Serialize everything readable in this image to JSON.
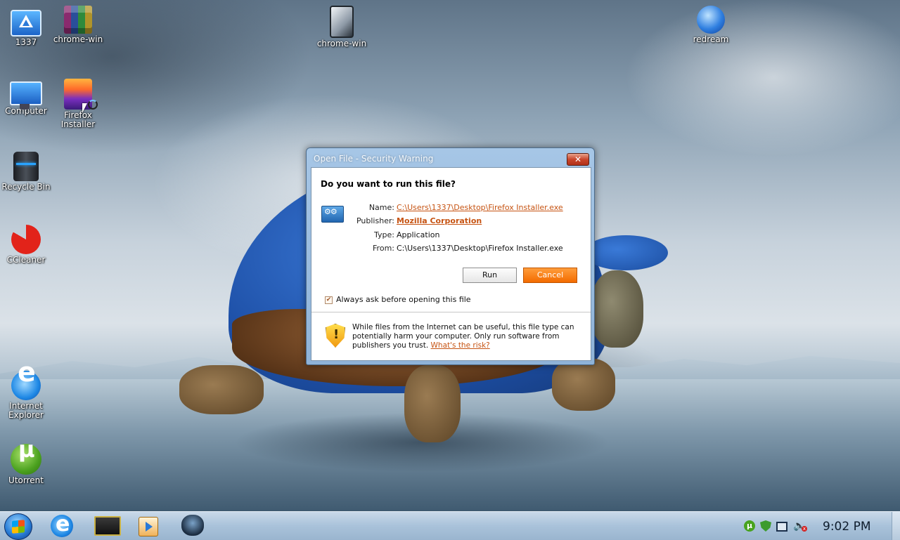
{
  "desktop": {
    "icons": [
      {
        "label": "1337",
        "icon": "triangle-logo-icon"
      },
      {
        "label": "chrome-win",
        "icon": "books-archive-icon"
      },
      {
        "label": "chrome-win",
        "icon": "phone-icon"
      },
      {
        "label": "redream",
        "icon": "redream-swirl-icon"
      },
      {
        "label": "Computer",
        "icon": "computer-icon"
      },
      {
        "label": "Firefox\nInstaller",
        "icon": "installer-icon"
      },
      {
        "label": "Recycle Bin",
        "icon": "recycle-bin-icon"
      },
      {
        "label": "CCleaner",
        "icon": "ccleaner-icon"
      },
      {
        "label": "Internet\nExplorer",
        "icon": "internet-explorer-icon"
      },
      {
        "label": "Utorrent",
        "icon": "utorrent-icon"
      }
    ]
  },
  "dialog": {
    "title": "Open File - Security Warning",
    "close_glyph": "✕",
    "question": "Do you want to run this file?",
    "fields": [
      {
        "label": "Name:",
        "value": "C:\\Users\\1337\\Desktop\\Firefox Installer.exe"
      },
      {
        "label": "Publisher:",
        "value": "Mozilla Corporation"
      },
      {
        "label": "Type:",
        "value": "Application"
      },
      {
        "label": "From:",
        "value": "C:\\Users\\1337\\Desktop\\Firefox Installer.exe"
      }
    ],
    "run_label": "Run",
    "cancel_label": "Cancel",
    "checkbox_label": "Always ask before opening this file",
    "checkbox_checked": true,
    "checkbox_glyph": "✔",
    "warning_text": "While files from the Internet can be useful, this file type can potentially harm your computer. Only run software from publishers you trust.",
    "risk_link": "What's the risk?"
  },
  "taskbar": {
    "pinned": [
      "internet-explorer-icon",
      "monitor-icon",
      "media-player-icon",
      "spider-icon"
    ],
    "tray": [
      "utorrent-icon",
      "shield-check-icon",
      "network-icon",
      "volume-muted-icon"
    ],
    "volume_glyph": "🔈",
    "volume_x_glyph": "x",
    "utorrent_glyph": "µ",
    "clock": "9:02 PM"
  },
  "colors": {
    "link": "#c65312",
    "cancel_button": "#f36b00",
    "close_button": "#c9462c"
  }
}
